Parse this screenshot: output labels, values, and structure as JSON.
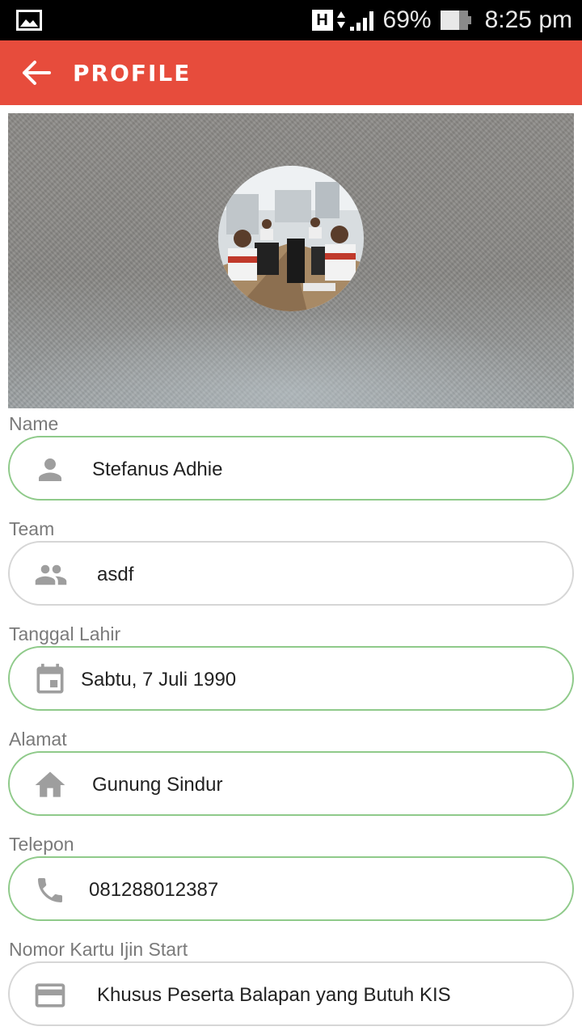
{
  "status_bar": {
    "network": "H",
    "battery": "69%",
    "time": "8:25 pm"
  },
  "appbar": {
    "title": "PROFILE"
  },
  "fields": [
    {
      "label": "Name",
      "value": "Stefanus Adhie",
      "icon": "person-icon"
    },
    {
      "label": "Team",
      "value": "asdf",
      "icon": "group-icon"
    },
    {
      "label": "Tanggal Lahir",
      "value": "Sabtu, 7 Juli 1990",
      "icon": "calendar-icon"
    },
    {
      "label": "Alamat",
      "value": "Gunung Sindur",
      "icon": "home-icon"
    },
    {
      "label": "Telepon",
      "value": "081288012387",
      "icon": "phone-icon"
    },
    {
      "label": "Nomor Kartu Ijin Start",
      "value": "Khusus Peserta Balapan yang Butuh KIS",
      "icon": "card-icon"
    }
  ],
  "colors": {
    "appbar": "#e74c3c",
    "field_border_active": "#8fca8a",
    "field_border_inactive": "#d6d6d6",
    "icon": "#9e9e9e"
  }
}
